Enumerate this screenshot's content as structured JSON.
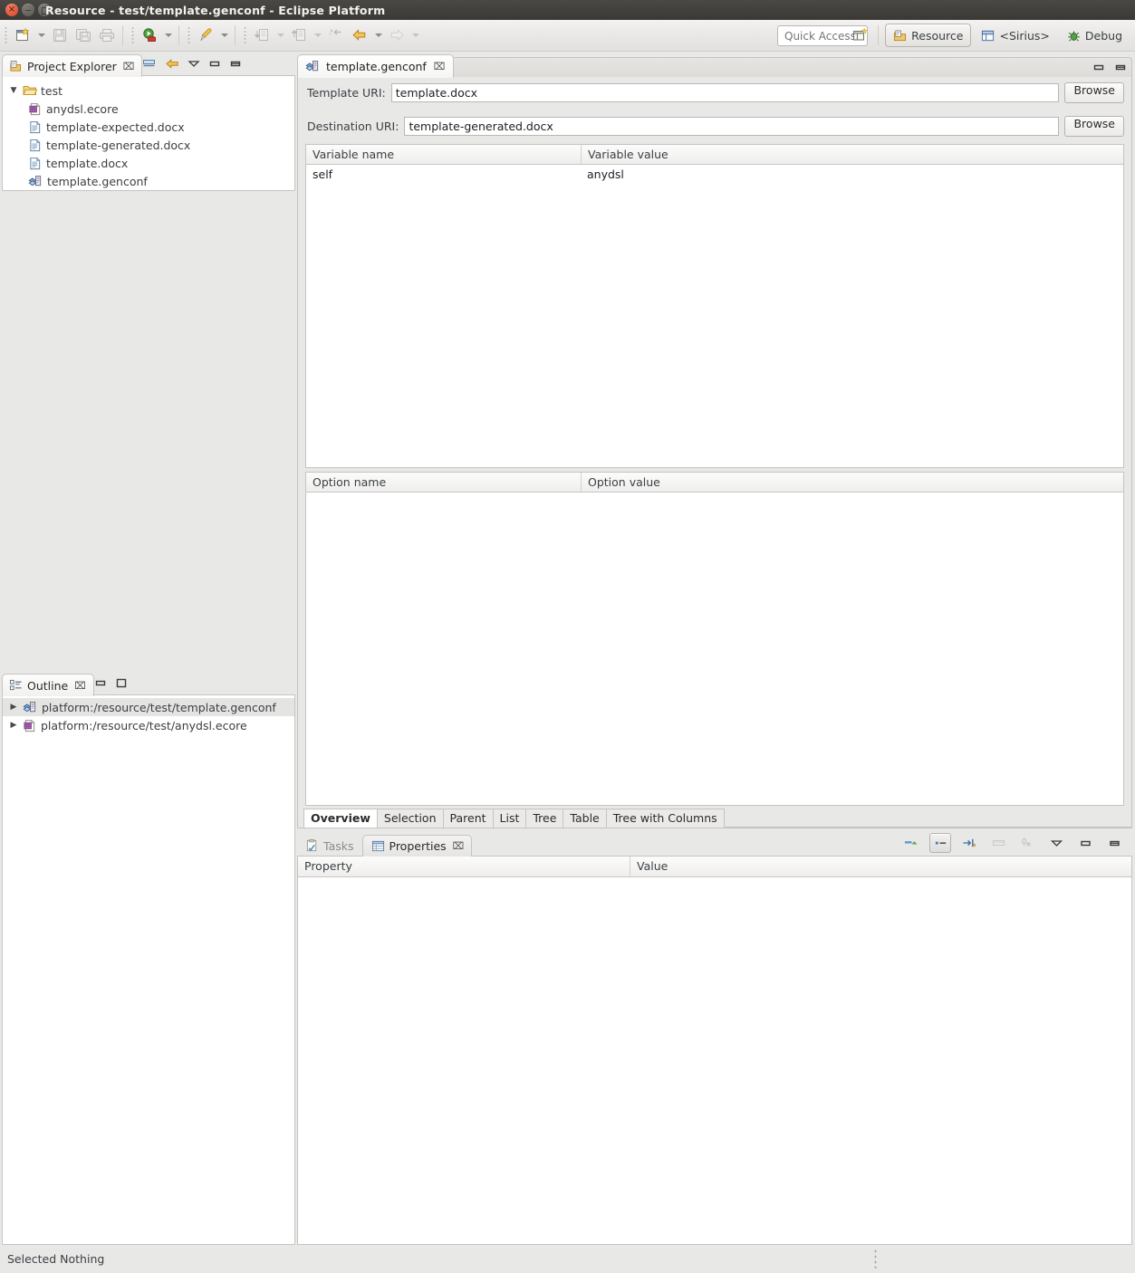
{
  "window": {
    "title": "Resource - test/template.genconf - Eclipse Platform",
    "buttons": [
      "close",
      "minimize",
      "maximize"
    ]
  },
  "toolbar": {
    "items": [
      {
        "name": "new-wizard",
        "icon": "new-file-icon",
        "enabled": true,
        "has_arrow": true
      },
      {
        "name": "save",
        "icon": "save-icon",
        "enabled": false,
        "has_arrow": false
      },
      {
        "name": "save-all",
        "icon": "save-all-icon",
        "enabled": false,
        "has_arrow": false
      },
      {
        "name": "print",
        "icon": "print-icon",
        "enabled": false,
        "has_arrow": false
      },
      {
        "name": "run",
        "icon": "run-icon",
        "enabled": true,
        "has_arrow": true
      },
      {
        "name": "external-tools",
        "icon": "external-tools-icon",
        "enabled": true,
        "has_arrow": true
      },
      {
        "name": "previous-annotation",
        "icon": "prev-annotation-icon",
        "enabled": false,
        "has_arrow": true
      },
      {
        "name": "next-annotation",
        "icon": "next-annotation-icon",
        "enabled": false,
        "has_arrow": true
      },
      {
        "name": "last-edit-location",
        "icon": "last-edit-icon",
        "enabled": false,
        "has_arrow": false
      },
      {
        "name": "back",
        "icon": "back-arrow-icon",
        "enabled": true,
        "has_arrow": true
      },
      {
        "name": "forward",
        "icon": "forward-arrow-icon",
        "enabled": false,
        "has_arrow": true
      }
    ],
    "quick_access_placeholder": "Quick Access",
    "open_perspective_icon": "open-perspective-icon",
    "perspectives": [
      {
        "label": "Resource",
        "icon": "resource-perspective-icon",
        "active": true
      },
      {
        "label": "<Sirius>",
        "icon": "sirius-perspective-icon",
        "active": false
      },
      {
        "label": "Debug",
        "icon": "debug-perspective-icon",
        "active": false
      }
    ]
  },
  "project_explorer": {
    "title": "Project Explorer",
    "close_glyph": "⌧",
    "toolbar_icons": [
      "collapse-all-icon",
      "link-with-editor-icon",
      "view-menu-icon",
      "minimize-icon",
      "maximize-icon"
    ],
    "tree": [
      {
        "label": "test",
        "icon": "folder-icon",
        "depth": 0,
        "expanded": true
      },
      {
        "label": "anydsl.ecore",
        "icon": "ecore-model-icon",
        "depth": 1,
        "expanded": null
      },
      {
        "label": "template-expected.docx",
        "icon": "document-icon",
        "depth": 1,
        "expanded": null
      },
      {
        "label": "template-generated.docx",
        "icon": "document-icon",
        "depth": 1,
        "expanded": null
      },
      {
        "label": "template.docx",
        "icon": "document-icon",
        "depth": 1,
        "expanded": null
      },
      {
        "label": "template.genconf",
        "icon": "genconf-icon",
        "depth": 1,
        "expanded": null
      }
    ]
  },
  "outline": {
    "title": "Outline",
    "close_glyph": "⌧",
    "toolbar_icons": [
      "minimize-icon",
      "maximize-icon"
    ],
    "items": [
      {
        "label": "platform:/resource/test/template.genconf",
        "icon": "genconf-icon",
        "selected": true
      },
      {
        "label": "platform:/resource/test/anydsl.ecore",
        "icon": "ecore-model-icon",
        "selected": false
      }
    ]
  },
  "editor": {
    "tab": {
      "label": "template.genconf",
      "icon": "genconf-icon",
      "close_glyph": "⌧"
    },
    "tools_icons": [
      "minimize-icon",
      "maximize-icon"
    ],
    "fields": [
      {
        "label": "Template URI:",
        "value": "template.docx",
        "button": "Browse"
      },
      {
        "label": "Destination URI:",
        "value": "template-generated.docx",
        "button": "Browse"
      }
    ],
    "variables_table": {
      "columns": [
        "Variable name",
        "Variable value"
      ],
      "rows": [
        [
          "self",
          "anydsl"
        ]
      ]
    },
    "options_table": {
      "columns": [
        "Option name",
        "Option value"
      ],
      "rows": []
    },
    "page_tabs": [
      {
        "label": "Overview",
        "selected": true
      },
      {
        "label": "Selection",
        "selected": false
      },
      {
        "label": "Parent",
        "selected": false
      },
      {
        "label": "List",
        "selected": false
      },
      {
        "label": "Tree",
        "selected": false
      },
      {
        "label": "Table",
        "selected": false
      },
      {
        "label": "Tree with Columns",
        "selected": false
      }
    ]
  },
  "bottom_panel": {
    "tabs": [
      {
        "label": "Tasks",
        "icon": "tasks-icon",
        "active": false
      },
      {
        "label": "Properties",
        "icon": "properties-icon",
        "active": true,
        "close_glyph": "⌧"
      }
    ],
    "toolbar_icons": [
      {
        "name": "show-advanced-properties-icon",
        "pressed": false,
        "enabled": true
      },
      {
        "name": "show-categories-icon",
        "pressed": true,
        "enabled": true
      },
      {
        "name": "restore-default-value-icon",
        "pressed": false,
        "enabled": true
      },
      {
        "name": "pin-to-selection-icon",
        "pressed": false,
        "enabled": false
      },
      {
        "name": "filter-icon",
        "pressed": false,
        "enabled": false
      },
      {
        "name": "view-menu-icon",
        "pressed": false,
        "enabled": true
      },
      {
        "name": "minimize-icon",
        "pressed": false,
        "enabled": true
      },
      {
        "name": "maximize-icon",
        "pressed": false,
        "enabled": true
      }
    ],
    "columns": [
      "Property",
      "Value"
    ],
    "rows": []
  },
  "status_bar": {
    "message": "Selected Nothing"
  },
  "colors": {
    "titlebar_top": "#4a4845",
    "titlebar_bottom": "#3b3936",
    "chrome": "#e8e8e7",
    "border": "#c6c4c0",
    "selection": "#e4e4e3",
    "accent_orange": "#d6492a",
    "folder_gold": "#f0c36d",
    "text": "#3c4043"
  }
}
